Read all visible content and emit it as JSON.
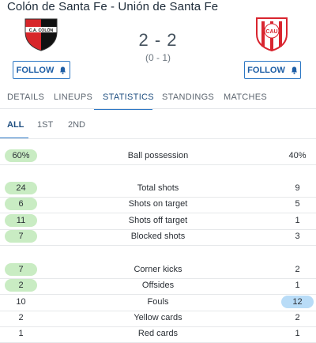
{
  "match": {
    "title": "Colón de Santa Fe - Unión de Santa Fe",
    "score": "2 - 2",
    "halftime": "(0 - 1)",
    "home": {
      "crest_text": "C.A. COLÓN",
      "crest_icon": "colon-crest-icon",
      "colors": [
        "#d7262a",
        "#111111"
      ]
    },
    "away": {
      "crest_text": "CAU",
      "crest_icon": "union-crest-icon",
      "colors": [
        "#d9252f",
        "#ffffff"
      ]
    },
    "follow_label": "FOLLOW"
  },
  "tabs": [
    {
      "label": "DETAILS"
    },
    {
      "label": "LINEUPS"
    },
    {
      "label": "STATISTICS",
      "active": true
    },
    {
      "label": "STANDINGS"
    },
    {
      "label": "MATCHES"
    }
  ],
  "subtabs": [
    {
      "label": "ALL",
      "active": true
    },
    {
      "label": "1ST"
    },
    {
      "label": "2ND"
    }
  ],
  "stats": [
    {
      "label": "Ball possession",
      "home": "60%",
      "away": "40%",
      "leader": "home"
    },
    {
      "label": "Total shots",
      "home": "24",
      "away": "9",
      "leader": "home"
    },
    {
      "label": "Shots on target",
      "home": "6",
      "away": "5",
      "leader": "home"
    },
    {
      "label": "Shots off target",
      "home": "11",
      "away": "1",
      "leader": "home"
    },
    {
      "label": "Blocked shots",
      "home": "7",
      "away": "3",
      "leader": "home"
    },
    {
      "label": "Corner kicks",
      "home": "7",
      "away": "2",
      "leader": "home"
    },
    {
      "label": "Offsides",
      "home": "2",
      "away": "1",
      "leader": "home"
    },
    {
      "label": "Fouls",
      "home": "10",
      "away": "12",
      "leader": "away"
    },
    {
      "label": "Yellow cards",
      "home": "2",
      "away": "2",
      "leader": "none"
    },
    {
      "label": "Red cards",
      "home": "1",
      "away": "1",
      "leader": "none"
    }
  ],
  "colors": {
    "accent": "#2c77c4",
    "home_highlight": "#c9ecc3",
    "away_highlight": "#b9dcf7"
  }
}
